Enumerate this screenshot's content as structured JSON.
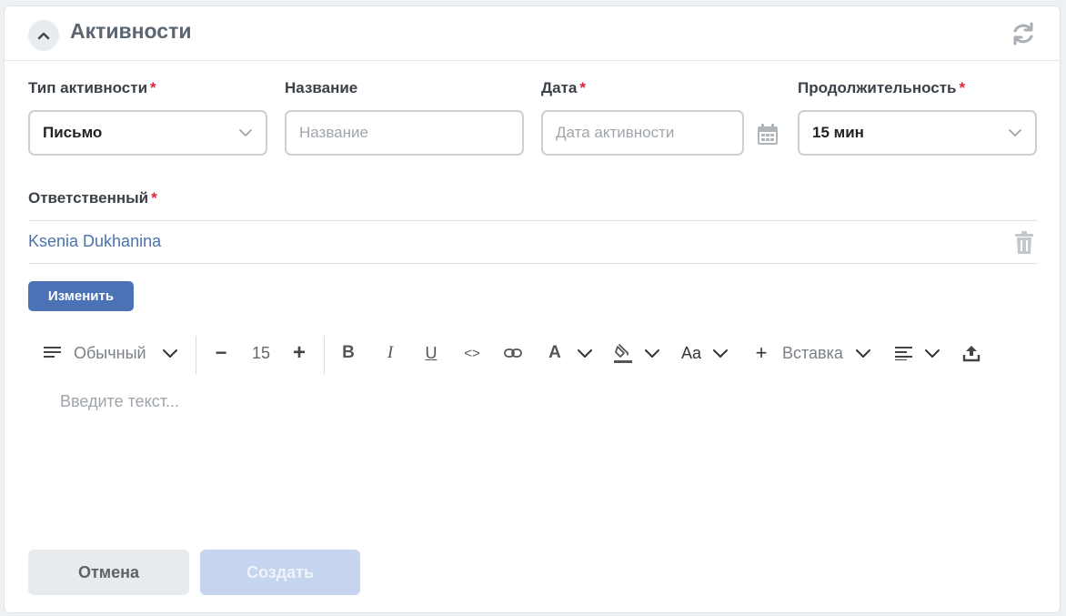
{
  "header": {
    "title": "Активности"
  },
  "form": {
    "activity_type": {
      "label": "Тип активности",
      "required_mark": "*",
      "value": "Письмо"
    },
    "name": {
      "label": "Название",
      "placeholder": "Название"
    },
    "date": {
      "label": "Дата",
      "required_mark": "*",
      "placeholder": "Дата активности"
    },
    "duration": {
      "label": "Продолжительность",
      "required_mark": "*",
      "value": "15 мин"
    },
    "responsible": {
      "label": "Ответственный",
      "required_mark": "*",
      "value": "Ksenia Dukhanina"
    },
    "change_button": "Изменить"
  },
  "toolbar": {
    "paragraph_style": "Обычный",
    "font_size": "15",
    "decrease": "−",
    "increase": "+",
    "bold": "B",
    "italic": "I",
    "underline": "U",
    "code": "<>",
    "font_color": "A",
    "text_case": "Aa",
    "insert_plus": "+",
    "insert": "Вставка"
  },
  "editor": {
    "placeholder": "Введите текст..."
  },
  "actions": {
    "cancel": "Отмена",
    "create": "Создать"
  },
  "colors": {
    "accent": "#4c72b6",
    "required": "#e0243a",
    "link": "#4a73ae"
  }
}
